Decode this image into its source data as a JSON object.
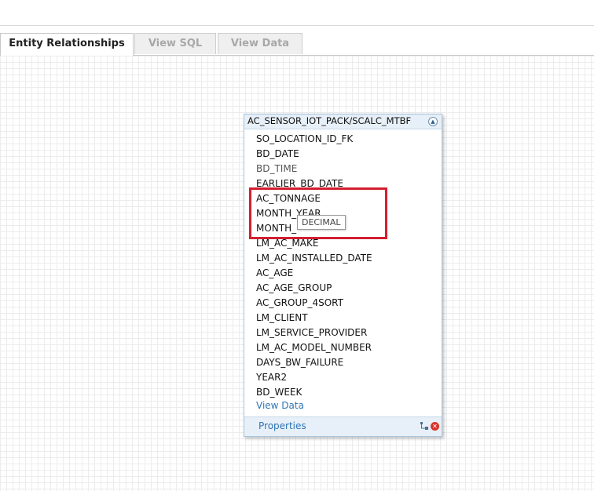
{
  "tabs": [
    {
      "label": "Entity Relationships",
      "active": true
    },
    {
      "label": "View SQL",
      "active": false
    },
    {
      "label": "View Data",
      "active": false
    }
  ],
  "entity": {
    "title": "AC_SENSOR_IOT_PACK/SCALC_MTBF",
    "collapse_icon": "chevron-up-icon",
    "columns": [
      "SO_LOCATION_ID_FK",
      "BD_DATE",
      "BD_TIME",
      "EARLIER_BD_DATE",
      "AC_TONNAGE",
      "MONTH_YEAR",
      "MONTH_",
      "LM_AC_MAKE",
      "LM_AC_INSTALLED_DATE",
      "AC_AGE",
      "AC_AGE_GROUP",
      "AC_GROUP_4SORT",
      "LM_CLIENT",
      "LM_SERVICE_PROVIDER",
      "LM_AC_MODEL_NUMBER",
      "DAYS_BW_FAILURE",
      "YEAR2",
      "BD_WEEK"
    ],
    "view_data_label": "View Data",
    "properties_label": "Properties"
  },
  "tooltip": {
    "text": "DECIMAL"
  },
  "colors": {
    "highlight": "#d21f2e",
    "link": "#2f75b5",
    "header_bg": "#e7f0f8"
  }
}
